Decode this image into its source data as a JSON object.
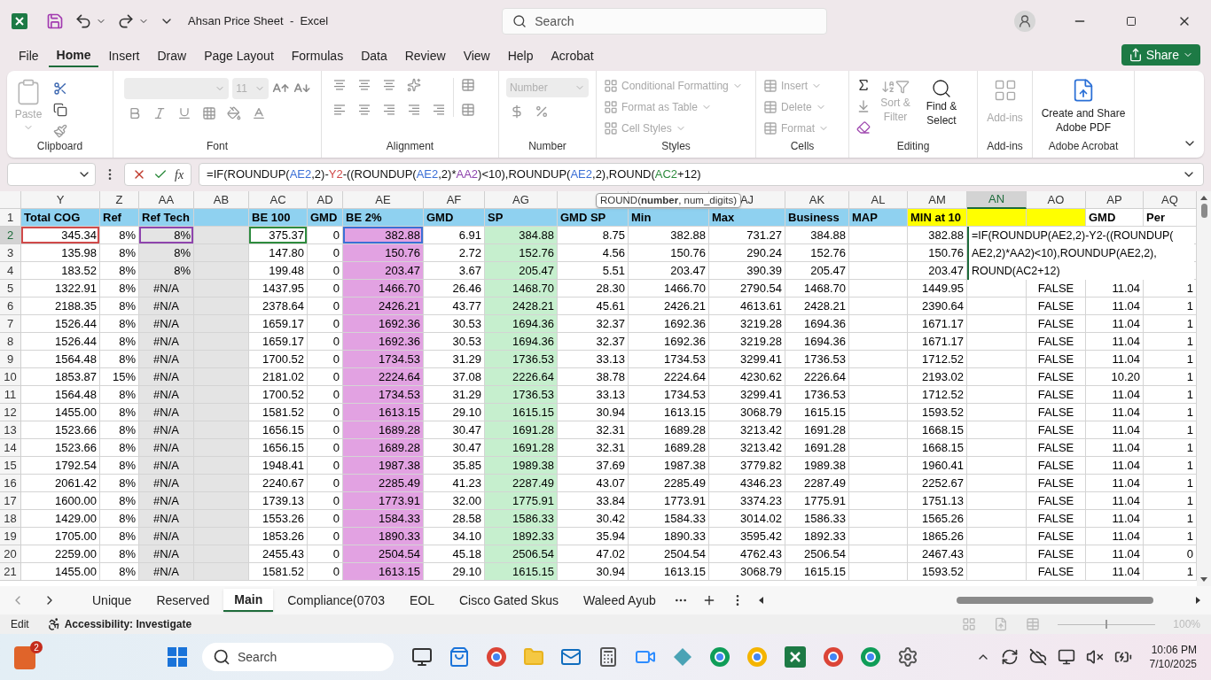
{
  "titlebar": {
    "title": "Ahsan Price Sheet  -  Excel",
    "search_placeholder": "Search"
  },
  "menu_tabs": [
    {
      "label": "File",
      "selected": false
    },
    {
      "label": "Home",
      "selected": true
    },
    {
      "label": "Insert",
      "selected": false
    },
    {
      "label": "Draw",
      "selected": false
    },
    {
      "label": "Page Layout",
      "selected": false
    },
    {
      "label": "Formulas",
      "selected": false
    },
    {
      "label": "Data",
      "selected": false
    },
    {
      "label": "Review",
      "selected": false
    },
    {
      "label": "View",
      "selected": false
    },
    {
      "label": "Help",
      "selected": false
    },
    {
      "label": "Acrobat",
      "selected": false
    }
  ],
  "share": "Share",
  "ribbon": {
    "clipboard": {
      "label": "Clipboard",
      "paste": "Paste"
    },
    "font": {
      "label": "Font",
      "size": "11"
    },
    "alignment": {
      "label": "Alignment"
    },
    "number": {
      "label": "Number",
      "format": "Number"
    },
    "styles": {
      "label": "Styles",
      "items": [
        {
          "label": "Conditional Formatting",
          "disabled": true
        },
        {
          "label": "Format as Table",
          "disabled": true
        },
        {
          "label": "Cell Styles",
          "disabled": true
        }
      ]
    },
    "cells": {
      "label": "Cells",
      "items": [
        {
          "label": "Insert",
          "disabled": true
        },
        {
          "label": "Delete",
          "disabled": true
        },
        {
          "label": "Format",
          "disabled": true
        }
      ]
    },
    "editing": {
      "label": "Editing",
      "sort": {
        "label": "Sort & Filter",
        "disabled": true
      },
      "find": {
        "label": "Find & Select",
        "disabled": false
      }
    },
    "addins": {
      "label": "Add-ins",
      "button": {
        "label": "Add-ins",
        "disabled": true
      }
    },
    "acrobat": {
      "label": "Adobe Acrobat",
      "button": {
        "label": "Create and Share Adobe PDF",
        "disabled": false
      }
    }
  },
  "fx": "fx",
  "formula": [
    {
      "t": "=IF(ROUNDUP("
    },
    {
      "t": "AE2",
      "color": "#3b6fd6"
    },
    {
      "t": ",2)-"
    },
    {
      "t": "Y2",
      "color": "#d04a4a"
    },
    {
      "t": "-((ROUNDUP("
    },
    {
      "t": "AE2",
      "color": "#3b6fd6"
    },
    {
      "t": ",2)*"
    },
    {
      "t": "AA2",
      "color": "#8e44ad"
    },
    {
      "t": ")<10),ROUNDUP("
    },
    {
      "t": "AE2",
      "color": "#3b6fd6"
    },
    {
      "t": ",2),ROUND("
    },
    {
      "t": "AC2",
      "color": "#2e8b3e"
    },
    {
      "t": "+12)"
    }
  ],
  "grid": {
    "columns": [
      {
        "letter": "Y",
        "selected": false
      },
      {
        "letter": "Z",
        "selected": false
      },
      {
        "letter": "AA",
        "selected": false,
        "color": "#e4e4e4"
      },
      {
        "letter": "AB",
        "selected": false,
        "color": "#e4e4e4"
      },
      {
        "letter": "AC",
        "selected": false
      },
      {
        "letter": "AD",
        "selected": false
      },
      {
        "letter": "AE",
        "selected": false,
        "color": "#e2a2e2"
      },
      {
        "letter": "AF",
        "selected": false
      },
      {
        "letter": "AG",
        "selected": false,
        "color": "#c6efce"
      },
      {
        "selected": false
      },
      {
        "selected": false
      },
      {
        "letter": "AJ",
        "selected": false
      },
      {
        "letter": "AK",
        "selected": false
      },
      {
        "letter": "AL",
        "selected": false
      },
      {
        "letter": "AM",
        "selected": false
      },
      {
        "letter": "AN",
        "selected": true
      },
      {
        "letter": "AO",
        "selected": false,
        "kind": "boolean"
      },
      {
        "letter": "AP",
        "selected": false
      },
      {
        "letter": "AQ",
        "selected": false
      }
    ],
    "rows": [
      {
        "n": "1",
        "kind": "header",
        "selected": false,
        "cells": [
          "Total COG",
          "Ref",
          "Ref Tech",
          null,
          "BE 100",
          "GMD",
          "BE 2%",
          "GMD",
          "SP",
          "GMD SP",
          "Min",
          "Max",
          "Business",
          "MAP",
          "MIN at 10",
          null,
          null,
          "GMD",
          "Per"
        ]
      },
      {
        "n": "2",
        "kind": "data",
        "selected": true,
        "cells": [
          "345.34",
          "8%",
          "8%",
          null,
          "375.37",
          "0",
          "382.88",
          "6.91",
          "384.88",
          "8.75",
          "382.88",
          "731.27",
          "384.88",
          null,
          "382.88",
          null,
          null,
          null,
          null
        ]
      },
      {
        "n": "3",
        "kind": "data",
        "selected": false,
        "cells": [
          "135.98",
          "8%",
          "8%",
          null,
          "147.80",
          "0",
          "150.76",
          "2.72",
          "152.76",
          "4.56",
          "150.76",
          "290.24",
          "152.76",
          null,
          "150.76",
          null,
          null,
          null,
          null
        ]
      },
      {
        "n": "4",
        "kind": "data",
        "selected": false,
        "cells": [
          "183.52",
          "8%",
          "8%",
          null,
          "199.48",
          "0",
          "203.47",
          "3.67",
          "205.47",
          "5.51",
          "203.47",
          "390.39",
          "205.47",
          null,
          "203.47",
          null,
          null,
          null,
          null
        ]
      },
      {
        "n": "5",
        "kind": "data",
        "selected": false,
        "cells": [
          "1322.91",
          "8%",
          {
            "v": "#N/A",
            "kind": "error"
          },
          null,
          "1437.95",
          "0",
          "1466.70",
          "26.46",
          "1468.70",
          "28.30",
          "1466.70",
          "2790.54",
          "1468.70",
          null,
          "1449.95",
          null,
          "FALSE",
          "11.04",
          "1"
        ]
      },
      {
        "n": "6",
        "kind": "data",
        "selected": false,
        "cells": [
          "2188.35",
          "8%",
          {
            "v": "#N/A",
            "kind": "error"
          },
          null,
          "2378.64",
          "0",
          "2426.21",
          "43.77",
          "2428.21",
          "45.61",
          "2426.21",
          "4613.61",
          "2428.21",
          null,
          "2390.64",
          null,
          "FALSE",
          "11.04",
          "1"
        ]
      },
      {
        "n": "7",
        "kind": "data",
        "selected": false,
        "cells": [
          "1526.44",
          "8%",
          {
            "v": "#N/A",
            "kind": "error"
          },
          null,
          "1659.17",
          "0",
          "1692.36",
          "30.53",
          "1694.36",
          "32.37",
          "1692.36",
          "3219.28",
          "1694.36",
          null,
          "1671.17",
          null,
          "FALSE",
          "11.04",
          "1"
        ]
      },
      {
        "n": "8",
        "kind": "data",
        "selected": false,
        "cells": [
          "1526.44",
          "8%",
          {
            "v": "#N/A",
            "kind": "error"
          },
          null,
          "1659.17",
          "0",
          "1692.36",
          "30.53",
          "1694.36",
          "32.37",
          "1692.36",
          "3219.28",
          "1694.36",
          null,
          "1671.17",
          null,
          "FALSE",
          "11.04",
          "1"
        ]
      },
      {
        "n": "9",
        "kind": "data",
        "selected": false,
        "cells": [
          "1564.48",
          "8%",
          {
            "v": "#N/A",
            "kind": "error"
          },
          null,
          "1700.52",
          "0",
          "1734.53",
          "31.29",
          "1736.53",
          "33.13",
          "1734.53",
          "3299.41",
          "1736.53",
          null,
          "1712.52",
          null,
          "FALSE",
          "11.04",
          "1"
        ]
      },
      {
        "n": "10",
        "kind": "data",
        "selected": false,
        "cells": [
          "1853.87",
          "15%",
          {
            "v": "#N/A",
            "kind": "error"
          },
          null,
          "2181.02",
          "0",
          "2224.64",
          "37.08",
          "2226.64",
          "38.78",
          "2224.64",
          "4230.62",
          "2226.64",
          null,
          "2193.02",
          null,
          "FALSE",
          "10.20",
          "1"
        ]
      },
      {
        "n": "11",
        "kind": "data",
        "selected": false,
        "cells": [
          "1564.48",
          "8%",
          {
            "v": "#N/A",
            "kind": "error"
          },
          null,
          "1700.52",
          "0",
          "1734.53",
          "31.29",
          "1736.53",
          "33.13",
          "1734.53",
          "3299.41",
          "1736.53",
          null,
          "1712.52",
          null,
          "FALSE",
          "11.04",
          "1"
        ]
      },
      {
        "n": "12",
        "kind": "data",
        "selected": false,
        "cells": [
          "1455.00",
          "8%",
          {
            "v": "#N/A",
            "kind": "error"
          },
          null,
          "1581.52",
          "0",
          "1613.15",
          "29.10",
          "1615.15",
          "30.94",
          "1613.15",
          "3068.79",
          "1615.15",
          null,
          "1593.52",
          null,
          "FALSE",
          "11.04",
          "1"
        ]
      },
      {
        "n": "13",
        "kind": "data",
        "selected": false,
        "cells": [
          "1523.66",
          "8%",
          {
            "v": "#N/A",
            "kind": "error"
          },
          null,
          "1656.15",
          "0",
          "1689.28",
          "30.47",
          "1691.28",
          "32.31",
          "1689.28",
          "3213.42",
          "1691.28",
          null,
          "1668.15",
          null,
          "FALSE",
          "11.04",
          "1"
        ]
      },
      {
        "n": "14",
        "kind": "data",
        "selected": false,
        "cells": [
          "1523.66",
          "8%",
          {
            "v": "#N/A",
            "kind": "error"
          },
          null,
          "1656.15",
          "0",
          "1689.28",
          "30.47",
          "1691.28",
          "32.31",
          "1689.28",
          "3213.42",
          "1691.28",
          null,
          "1668.15",
          null,
          "FALSE",
          "11.04",
          "1"
        ]
      },
      {
        "n": "15",
        "kind": "data",
        "selected": false,
        "cells": [
          "1792.54",
          "8%",
          {
            "v": "#N/A",
            "kind": "error"
          },
          null,
          "1948.41",
          "0",
          "1987.38",
          "35.85",
          "1989.38",
          "37.69",
          "1987.38",
          "3779.82",
          "1989.38",
          null,
          "1960.41",
          null,
          "FALSE",
          "11.04",
          "1"
        ]
      },
      {
        "n": "16",
        "kind": "data",
        "selected": false,
        "cells": [
          "2061.42",
          "8%",
          {
            "v": "#N/A",
            "kind": "error"
          },
          null,
          "2240.67",
          "0",
          "2285.49",
          "41.23",
          "2287.49",
          "43.07",
          "2285.49",
          "4346.23",
          "2287.49",
          null,
          "2252.67",
          null,
          "FALSE",
          "11.04",
          "1"
        ]
      },
      {
        "n": "17",
        "kind": "data",
        "selected": false,
        "cells": [
          "1600.00",
          "8%",
          {
            "v": "#N/A",
            "kind": "error"
          },
          null,
          "1739.13",
          "0",
          "1773.91",
          "32.00",
          "1775.91",
          "33.84",
          "1773.91",
          "3374.23",
          "1775.91",
          null,
          "1751.13",
          null,
          "FALSE",
          "11.04",
          "1"
        ]
      },
      {
        "n": "18",
        "kind": "data",
        "selected": false,
        "cells": [
          "1429.00",
          "8%",
          {
            "v": "#N/A",
            "kind": "error"
          },
          null,
          "1553.26",
          "0",
          "1584.33",
          "28.58",
          "1586.33",
          "30.42",
          "1584.33",
          "3014.02",
          "1586.33",
          null,
          "1565.26",
          null,
          "FALSE",
          "11.04",
          "1"
        ]
      },
      {
        "n": "19",
        "kind": "data",
        "selected": false,
        "cells": [
          "1705.00",
          "8%",
          {
            "v": "#N/A",
            "kind": "error"
          },
          null,
          "1853.26",
          "0",
          "1890.33",
          "34.10",
          "1892.33",
          "35.94",
          "1890.33",
          "3595.42",
          "1892.33",
          null,
          "1865.26",
          null,
          "FALSE",
          "11.04",
          "1"
        ]
      },
      {
        "n": "20",
        "kind": "data",
        "selected": false,
        "cells": [
          "2259.00",
          "8%",
          {
            "v": "#N/A",
            "kind": "error"
          },
          null,
          "2455.43",
          "0",
          "2504.54",
          "45.18",
          "2506.54",
          "47.02",
          "2504.54",
          "4762.43",
          "2506.54",
          null,
          "2467.43",
          null,
          "FALSE",
          "11.04",
          "0"
        ]
      },
      {
        "n": "21",
        "kind": "data",
        "selected": false,
        "cells": [
          "1455.00",
          "8%",
          {
            "v": "#N/A",
            "kind": "error"
          },
          null,
          "1581.52",
          "0",
          "1613.15",
          "29.10",
          "1615.15",
          "30.94",
          "1613.15",
          "3068.79",
          "1615.15",
          null,
          "1593.52",
          null,
          "FALSE",
          "11.04",
          "1"
        ]
      }
    ],
    "cell_editor": [
      "=IF(ROUNDUP(AE2,2)-Y2-((ROUNDUP(",
      "AE2,2)*AA2)<10),ROUNDUP(AE2,2),",
      "ROUND(AC2+12)"
    ],
    "tooltip": "ROUND(**number**, num_digits)"
  },
  "sheet_tabs": [
    {
      "label": "Unique",
      "selected": false
    },
    {
      "label": "Reserved",
      "selected": false
    },
    {
      "label": "Main",
      "selected": true
    },
    {
      "label": "Compliance(0703",
      "selected": false
    },
    {
      "label": "EOL",
      "selected": false
    },
    {
      "label": "Cisco Gated Skus",
      "selected": false
    },
    {
      "label": "Waleed Ayub",
      "selected": false
    }
  ],
  "status": {
    "mode": "Edit",
    "accessibility": "Accessibility: Investigate",
    "zoom": "100%",
    "zoom_slider": {
      "level": 0.5
    }
  },
  "taskbar": {
    "badge": "2",
    "search_placeholder": "Search",
    "time": "10:06 PM",
    "date": "7/10/2025"
  }
}
